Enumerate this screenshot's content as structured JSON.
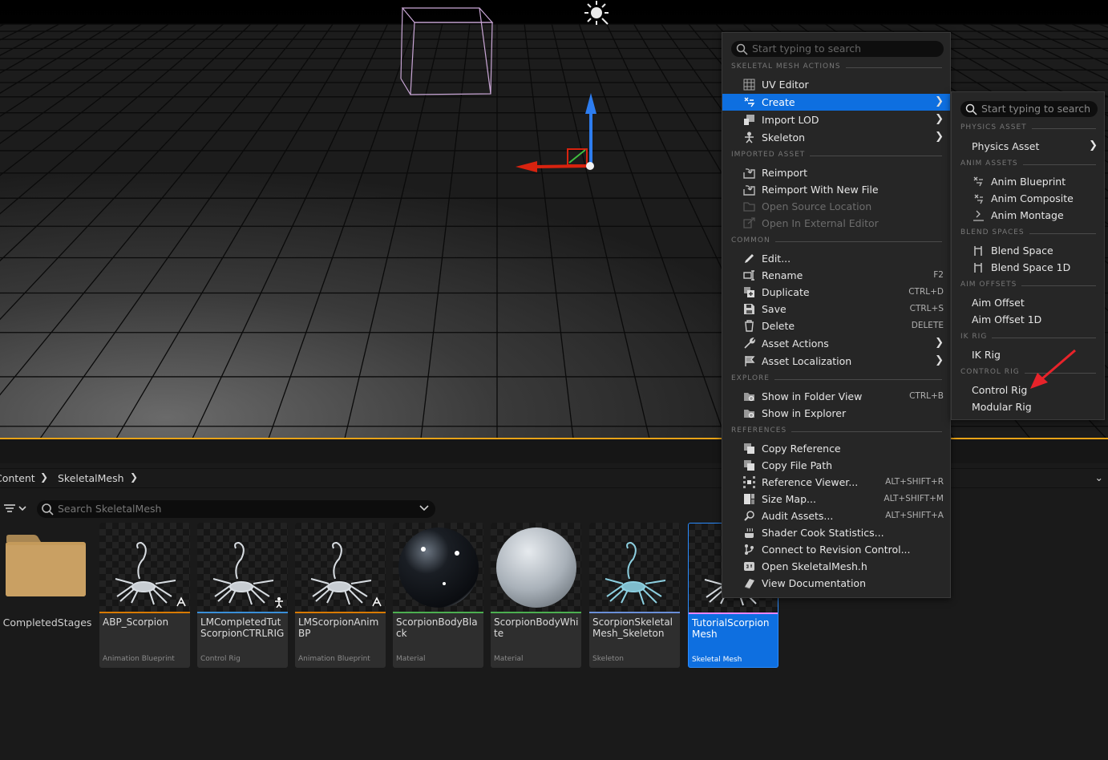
{
  "viewport": {
    "label": "level-viewport"
  },
  "breadcrumb": {
    "items": [
      "Content",
      "SkeletalMesh"
    ]
  },
  "asset_search": {
    "placeholder": "Search SkeletalMesh"
  },
  "folder": {
    "name": "CompletedStages"
  },
  "assets": [
    {
      "name": "ABP_Scorpion",
      "type": "Animation Blueprint",
      "stripe": "#d87a00"
    },
    {
      "name": "LMCompletedTut ScorpionCTRLRIG",
      "type": "Control Rig",
      "stripe": "#3a8fd8"
    },
    {
      "name": "LMScorpionAnim BP",
      "type": "Animation Blueprint",
      "stripe": "#d87a00"
    },
    {
      "name": "ScorpionBodyBlack",
      "type": "Material",
      "stripe": "#4caf50"
    },
    {
      "name": "ScorpionBodyWhite",
      "type": "Material",
      "stripe": "#4caf50"
    },
    {
      "name": "ScorpionSkeletal Mesh_Skeleton",
      "type": "Skeleton",
      "stripe": "#6a8fd8"
    },
    {
      "name": "TutorialScorpion Mesh",
      "type": "Skeletal Mesh",
      "stripe": "#e884ff"
    }
  ],
  "context_menu": {
    "search_placeholder": "Start typing to search",
    "sections": {
      "skeletal": "SKELETAL MESH ACTIONS",
      "imported": "IMPORTED ASSET",
      "common": "COMMON",
      "explore": "EXPLORE",
      "references": "REFERENCES"
    },
    "items": {
      "uv_editor": "UV Editor",
      "create": "Create",
      "import_lod": "Import LOD",
      "skeleton": "Skeleton",
      "reimport": "Reimport",
      "reimport_new": "Reimport With New File",
      "open_source": "Open Source Location",
      "open_external": "Open In External Editor",
      "edit": "Edit...",
      "rename": "Rename",
      "duplicate": "Duplicate",
      "save": "Save",
      "delete": "Delete",
      "asset_actions": "Asset Actions",
      "asset_localization": "Asset Localization",
      "show_folder": "Show in Folder View",
      "show_explorer": "Show in Explorer",
      "copy_reference": "Copy Reference",
      "copy_file_path": "Copy File Path",
      "reference_viewer": "Reference Viewer...",
      "size_map": "Size Map...",
      "audit_assets": "Audit Assets...",
      "shader_cook": "Shader Cook Statistics...",
      "connect_rc": "Connect to Revision Control...",
      "open_header": "Open SkeletalMesh.h",
      "view_docs": "View Documentation"
    },
    "shortcuts": {
      "rename": "F2",
      "duplicate": "CTRL+D",
      "save": "CTRL+S",
      "delete": "DELETE",
      "show_folder": "CTRL+B",
      "reference_viewer": "ALT+SHIFT+R",
      "size_map": "ALT+SHIFT+M",
      "audit_assets": "ALT+SHIFT+A"
    }
  },
  "create_submenu": {
    "search_placeholder": "Start typing to search",
    "sections": {
      "physics": "PHYSICS ASSET",
      "anim": "ANIM ASSETS",
      "blend": "BLEND SPACES",
      "aim": "AIM OFFSETS",
      "ik": "IK RIG",
      "control": "CONTROL RIG"
    },
    "items": {
      "physics_asset": "Physics Asset",
      "anim_blueprint": "Anim Blueprint",
      "anim_composite": "Anim Composite",
      "anim_montage": "Anim Montage",
      "blend_space": "Blend Space",
      "blend_space_1d": "Blend Space 1D",
      "aim_offset": "Aim Offset",
      "aim_offset_1d": "Aim Offset 1D",
      "ik_rig": "IK Rig",
      "control_rig": "Control Rig",
      "modular_rig": "Modular Rig"
    }
  },
  "colors": {
    "highlight": "#0e6fe0",
    "annotation_arrow": "#e8232a",
    "divider": "#e8a317"
  }
}
